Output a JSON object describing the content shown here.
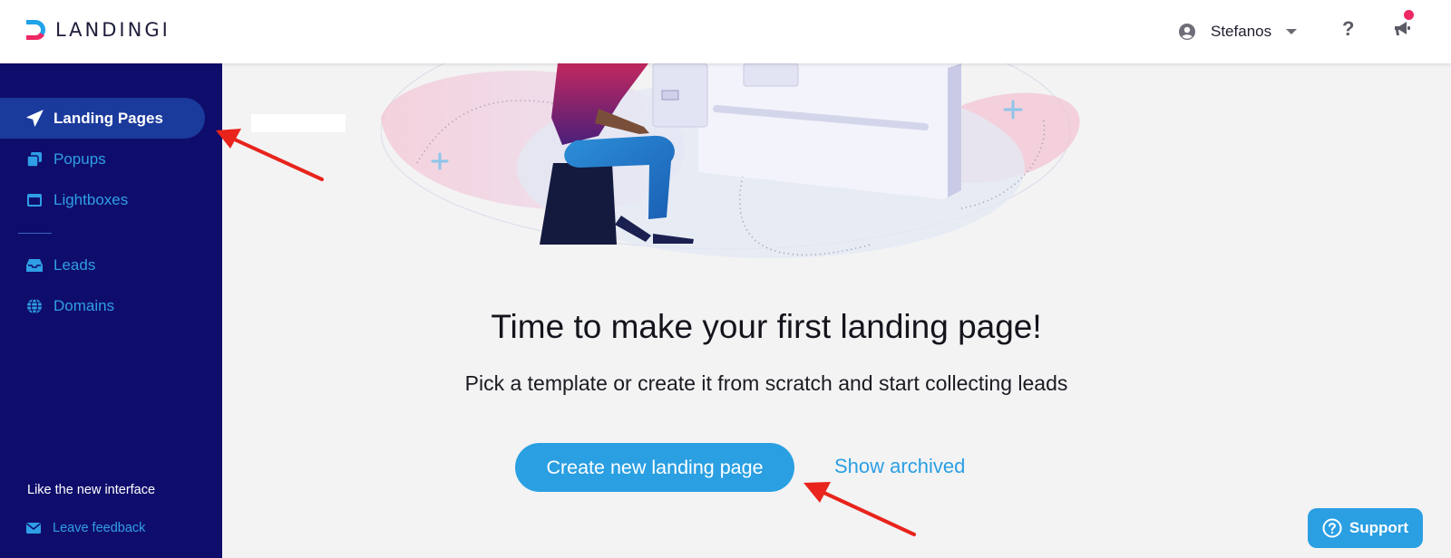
{
  "header": {
    "logo_text": "LANDINGI",
    "user_name": "Stefanos",
    "help_glyph": "?",
    "icons": [
      "user-avatar-icon",
      "chevron-down-icon",
      "help-icon",
      "megaphone-icon"
    ]
  },
  "sidebar": {
    "items": [
      {
        "label": "Landing Pages",
        "icon": "paper-plane-icon",
        "active": true
      },
      {
        "label": "Popups",
        "icon": "popups-icon",
        "active": false
      },
      {
        "label": "Lightboxes",
        "icon": "lightbox-icon",
        "active": false
      },
      {
        "label": "Leads",
        "icon": "inbox-icon",
        "active": false
      },
      {
        "label": "Domains",
        "icon": "globe-icon",
        "active": false
      }
    ],
    "like_text": "Like the new interface",
    "feedback_label": "Leave feedback"
  },
  "main": {
    "headline": "Time to make your first landing page!",
    "subline": "Pick a template or create it from scratch and start collecting leads",
    "create_button": "Create new landing page",
    "archived_link": "Show archived"
  },
  "support": {
    "label": "Support"
  },
  "colors": {
    "sidebar_bg": "#0f0d6b",
    "sidebar_active_bg": "#1a3a9c",
    "accent_blue": "#2a9fe2",
    "brand_pink": "#ee2863",
    "annotation_red": "#e8241c"
  }
}
